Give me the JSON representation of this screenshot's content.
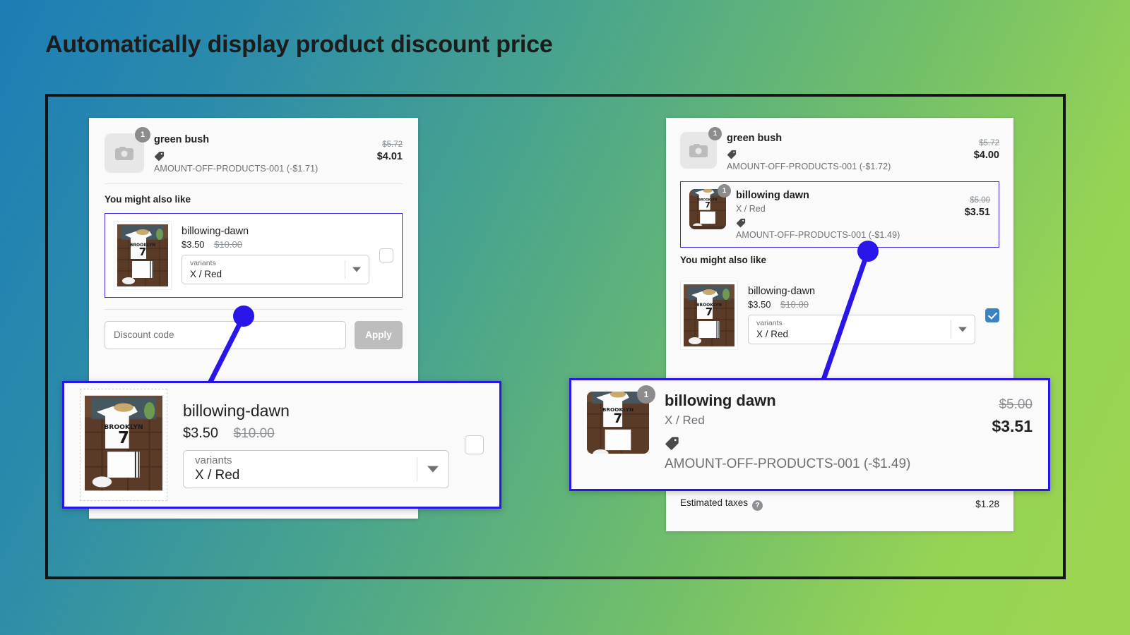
{
  "title": "Automatically display product discount price",
  "colors": {
    "accent_blue": "#2a16e8",
    "card_border_blue": "#4029e6",
    "checkbox_blue": "#3b82c4",
    "frame_black": "#141414",
    "bg_from": "#1d7db5",
    "bg_to": "#9cd54f"
  },
  "left_panel": {
    "line_item": {
      "name": "green bush",
      "quantity": "1",
      "discount_text": "AMOUNT-OFF-PRODUCTS-001 (-$1.71)",
      "price_old": "$5.72",
      "price_new": "$4.01",
      "image": "camera-placeholder"
    },
    "recommendation_heading": "You might also like",
    "recommendation": {
      "name": "billowing-dawn",
      "price_new": "$3.50",
      "price_old": "$10.00",
      "select_label": "variants",
      "select_value": "X / Red",
      "checked": false
    },
    "discount": {
      "placeholder": "Discount code",
      "apply_label": "Apply"
    }
  },
  "right_panel": {
    "line_item": {
      "name": "green bush",
      "quantity": "1",
      "discount_text": "AMOUNT-OFF-PRODUCTS-001 (-$1.72)",
      "price_old": "$5.72",
      "price_new": "$4.00",
      "image": "camera-placeholder"
    },
    "added_item": {
      "name": "billowing dawn",
      "quantity": "1",
      "variant": "X / Red",
      "discount_text": "AMOUNT-OFF-PRODUCTS-001 (-$1.49)",
      "price_old": "$5.00",
      "price_new": "$3.51"
    },
    "recommendation_heading": "You might also like",
    "recommendation": {
      "name": "billowing-dawn",
      "price_new": "$3.50",
      "price_old": "$10.00",
      "select_label": "variants",
      "select_value": "X / Red",
      "checked": true
    },
    "summary": {
      "taxes_label": "Estimated taxes",
      "taxes_value": "$1.28",
      "help_glyph": "?"
    }
  },
  "callout_left": {
    "name": "billowing-dawn",
    "price_new": "$3.50",
    "price_old": "$10.00",
    "select_label": "variants",
    "select_value": "X / Red"
  },
  "callout_right": {
    "name": "billowing dawn",
    "quantity": "1",
    "variant": "X / Red",
    "discount_text": "AMOUNT-OFF-PRODUCTS-001 (-$1.49)",
    "price_old": "$5.00",
    "price_new": "$3.51"
  }
}
